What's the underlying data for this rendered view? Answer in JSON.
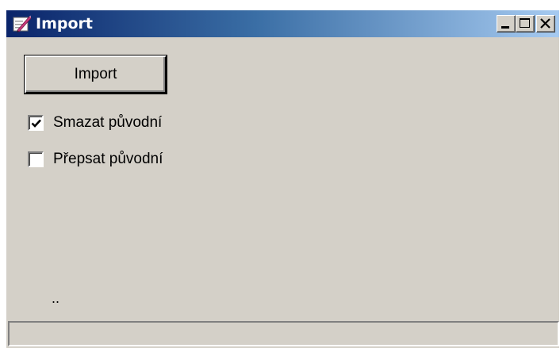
{
  "window": {
    "title": "Import",
    "icon": "import-app-icon",
    "controls": [
      "minimize-icon",
      "maximize-icon",
      "close-icon"
    ]
  },
  "main": {
    "import_button_label": "Import",
    "checkboxes": [
      {
        "label": "Smazat původní",
        "checked": true
      },
      {
        "label": "Přepsat původní",
        "checked": false
      }
    ],
    "status_text": ".."
  },
  "statusbar": {
    "text": ""
  },
  "colors": {
    "titlebar_start": "#0a246a",
    "titlebar_end": "#a6caf0",
    "window_bg": "#d4d0c8"
  }
}
